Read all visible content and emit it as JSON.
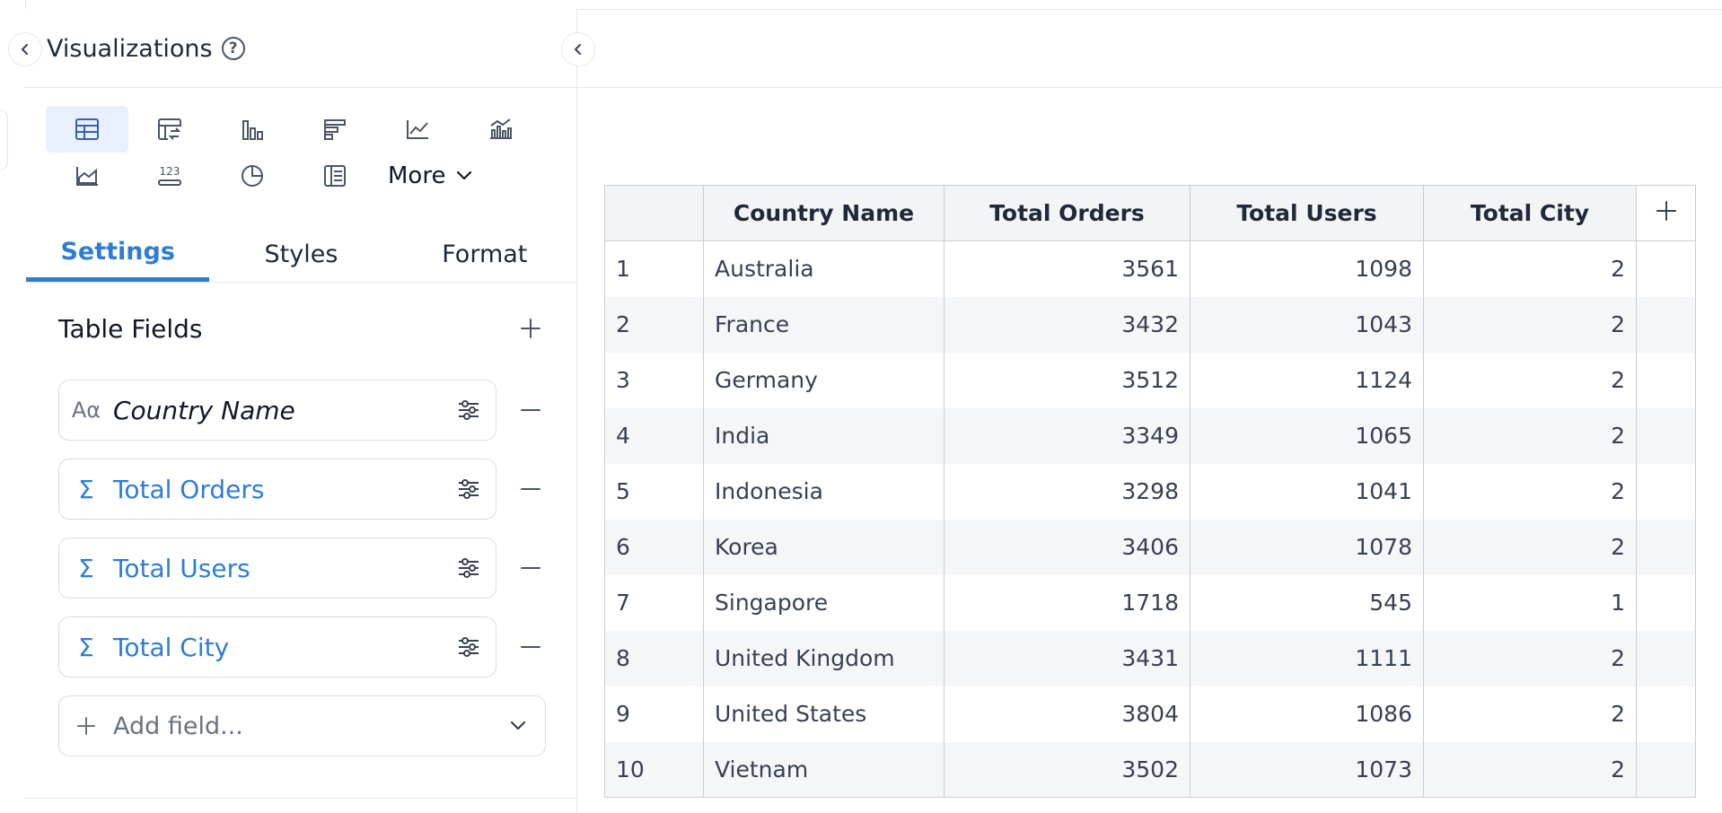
{
  "panel": {
    "title": "Visualizations",
    "help_icon": "question-circle-icon",
    "more_label": "More",
    "tabs": [
      {
        "label": "Settings",
        "active": true
      },
      {
        "label": "Styles",
        "active": false
      },
      {
        "label": "Format",
        "active": false
      }
    ],
    "section_title": "Table Fields",
    "fields": [
      {
        "type_glyph": "Aα",
        "name": "Country Name",
        "kind": "dimension"
      },
      {
        "type_glyph": "Σ",
        "name": "Total Orders",
        "kind": "measure"
      },
      {
        "type_glyph": "Σ",
        "name": "Total Users",
        "kind": "measure"
      },
      {
        "type_glyph": "Σ",
        "name": "Total City",
        "kind": "measure"
      }
    ],
    "add_field_placeholder": "Add field...",
    "viz_icons": [
      "table-icon",
      "pivot-table-icon",
      "bar-chart-icon",
      "horizontal-bar-chart-icon",
      "line-chart-icon",
      "combo-chart-icon",
      "area-chart-icon",
      "number-kpi-icon",
      "pie-chart-icon",
      "detail-list-icon"
    ],
    "accent": "#2f7dd3"
  },
  "table": {
    "columns": [
      "",
      "Country Name",
      "Total Orders",
      "Total Users",
      "Total City"
    ],
    "rows": [
      [
        "1",
        "Australia",
        "3561",
        "1098",
        "2"
      ],
      [
        "2",
        "France",
        "3432",
        "1043",
        "2"
      ],
      [
        "3",
        "Germany",
        "3512",
        "1124",
        "2"
      ],
      [
        "4",
        "India",
        "3349",
        "1065",
        "2"
      ],
      [
        "5",
        "Indonesia",
        "3298",
        "1041",
        "2"
      ],
      [
        "6",
        "Korea",
        "3406",
        "1078",
        "2"
      ],
      [
        "7",
        "Singapore",
        "1718",
        "545",
        "1"
      ],
      [
        "8",
        "United Kingdom",
        "3431",
        "1111",
        "2"
      ],
      [
        "9",
        "United States",
        "3804",
        "1086",
        "2"
      ],
      [
        "10",
        "Vietnam",
        "3502",
        "1073",
        "2"
      ]
    ]
  }
}
